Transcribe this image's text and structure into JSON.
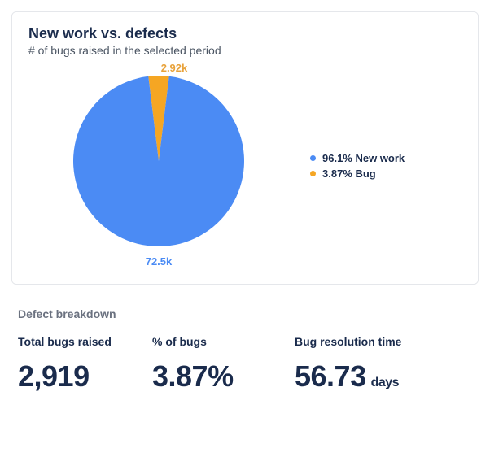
{
  "card": {
    "title": "New work vs. defects",
    "subtitle": "# of bugs raised in the selected period"
  },
  "chart_data": {
    "type": "pie",
    "title": "New work vs. defects",
    "series": [
      {
        "name": "New work",
        "value": 72500,
        "percent": 96.1,
        "color": "#4b8bf4",
        "label": "72.5k"
      },
      {
        "name": "Bug",
        "value": 2920,
        "percent": 3.87,
        "color": "#f5a623",
        "label": "2.92k"
      }
    ],
    "legend": [
      "96.1% New work",
      "3.87% Bug"
    ]
  },
  "breakdown": {
    "title": "Defect breakdown",
    "metrics": [
      {
        "label": "Total bugs raised",
        "value": "2,919",
        "unit": ""
      },
      {
        "label": "% of bugs",
        "value": "3.87%",
        "unit": ""
      },
      {
        "label": "Bug resolution time",
        "value": "56.73",
        "unit": "days"
      }
    ]
  }
}
